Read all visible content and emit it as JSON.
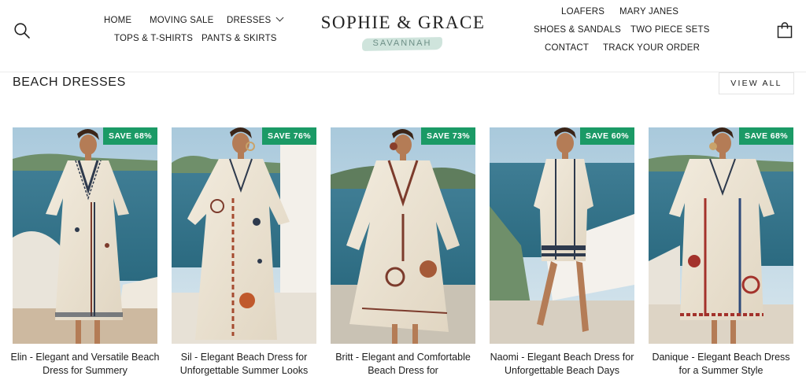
{
  "header": {
    "nav_left_row1": [
      {
        "label": "HOME"
      },
      {
        "label": "MOVING SALE"
      },
      {
        "label": "DRESSES"
      }
    ],
    "nav_left_row2": [
      {
        "label": "TOPS & T-SHIRTS"
      },
      {
        "label": "PANTS & SKIRTS"
      }
    ],
    "logo": {
      "title": "SOPHIE & GRACE",
      "subtitle": "SAVANNAH"
    },
    "nav_right_row1": [
      {
        "label": "LOAFERS"
      },
      {
        "label": "MARY JANES"
      }
    ],
    "nav_right_row2": [
      {
        "label": "SHOES & SANDALS"
      },
      {
        "label": "TWO PIECE SETS"
      }
    ],
    "nav_right_row3": [
      {
        "label": "CONTACT"
      },
      {
        "label": "TRACK YOUR ORDER"
      }
    ],
    "icons": {
      "search": "search-icon",
      "cart": "shopping-bag-icon",
      "dropdown": "chevron-down-icon"
    }
  },
  "section": {
    "title": "BEACH DRESSES",
    "view_all_label": "VIEW ALL"
  },
  "products": [
    {
      "badge": "SAVE 68%",
      "title": "Elin - Elegant and Versatile Beach Dress for Summery"
    },
    {
      "badge": "SAVE 76%",
      "title": "Sil - Elegant Beach Dress for Unforgettable Summer Looks"
    },
    {
      "badge": "SAVE 73%",
      "title": "Britt - Elegant and Comfortable Beach Dress for"
    },
    {
      "badge": "SAVE 60%",
      "title": "Naomi - Elegant Beach Dress for Unforgettable Beach Days"
    },
    {
      "badge": "SAVE 68%",
      "title": "Danique - Elegant Beach Dress for a Summer Style"
    }
  ],
  "colors": {
    "badge_bg": "#1b9a66",
    "logo_accent": "#cfe4dc",
    "text": "#1c1c1c"
  }
}
